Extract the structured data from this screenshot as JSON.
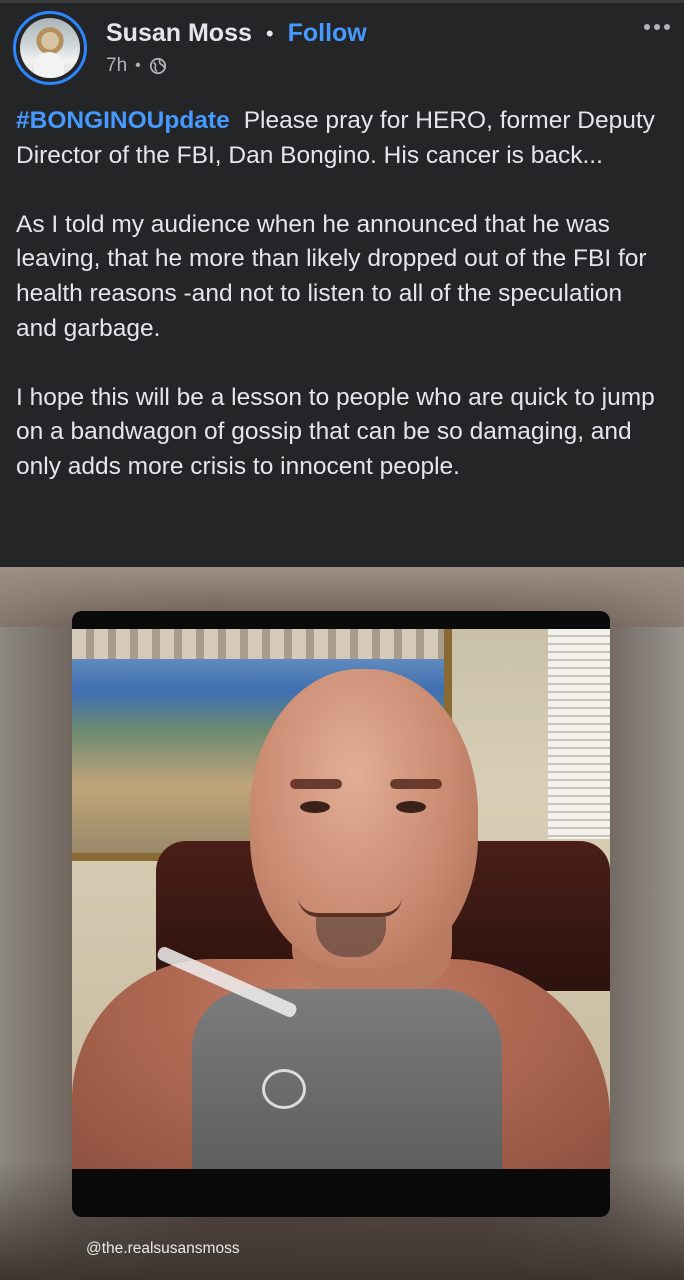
{
  "post": {
    "author": {
      "name": "Susan Moss",
      "follow_label": "Follow",
      "separator": "•",
      "avatar_icon": "profile-photo"
    },
    "meta": {
      "time": "7h",
      "separator": "•",
      "privacy_icon": "globe-icon"
    },
    "more_icon": "ellipsis-icon",
    "hashtag": "#BONGINOUpdate",
    "paragraphs": [
      "Please pray for HERO, former Deputy Director of the FBI, Dan Bongino.  His cancer is back...",
      "As I told my audience when he announced that he was leaving, that he more than likely dropped out of the FBI for health reasons -and not to listen to all of the speculation and garbage.",
      "I hope this will be a lesson to people who are quick to jump on a bandwagon of gossip that can be so damaging, and only adds more crisis to innocent people."
    ],
    "image": {
      "watermark": "@the.realsusansmoss"
    }
  },
  "colors": {
    "background": "#242526",
    "accent": "#4599ff",
    "text": "#e4e6eb",
    "secondary_text": "#b0b3b8"
  }
}
